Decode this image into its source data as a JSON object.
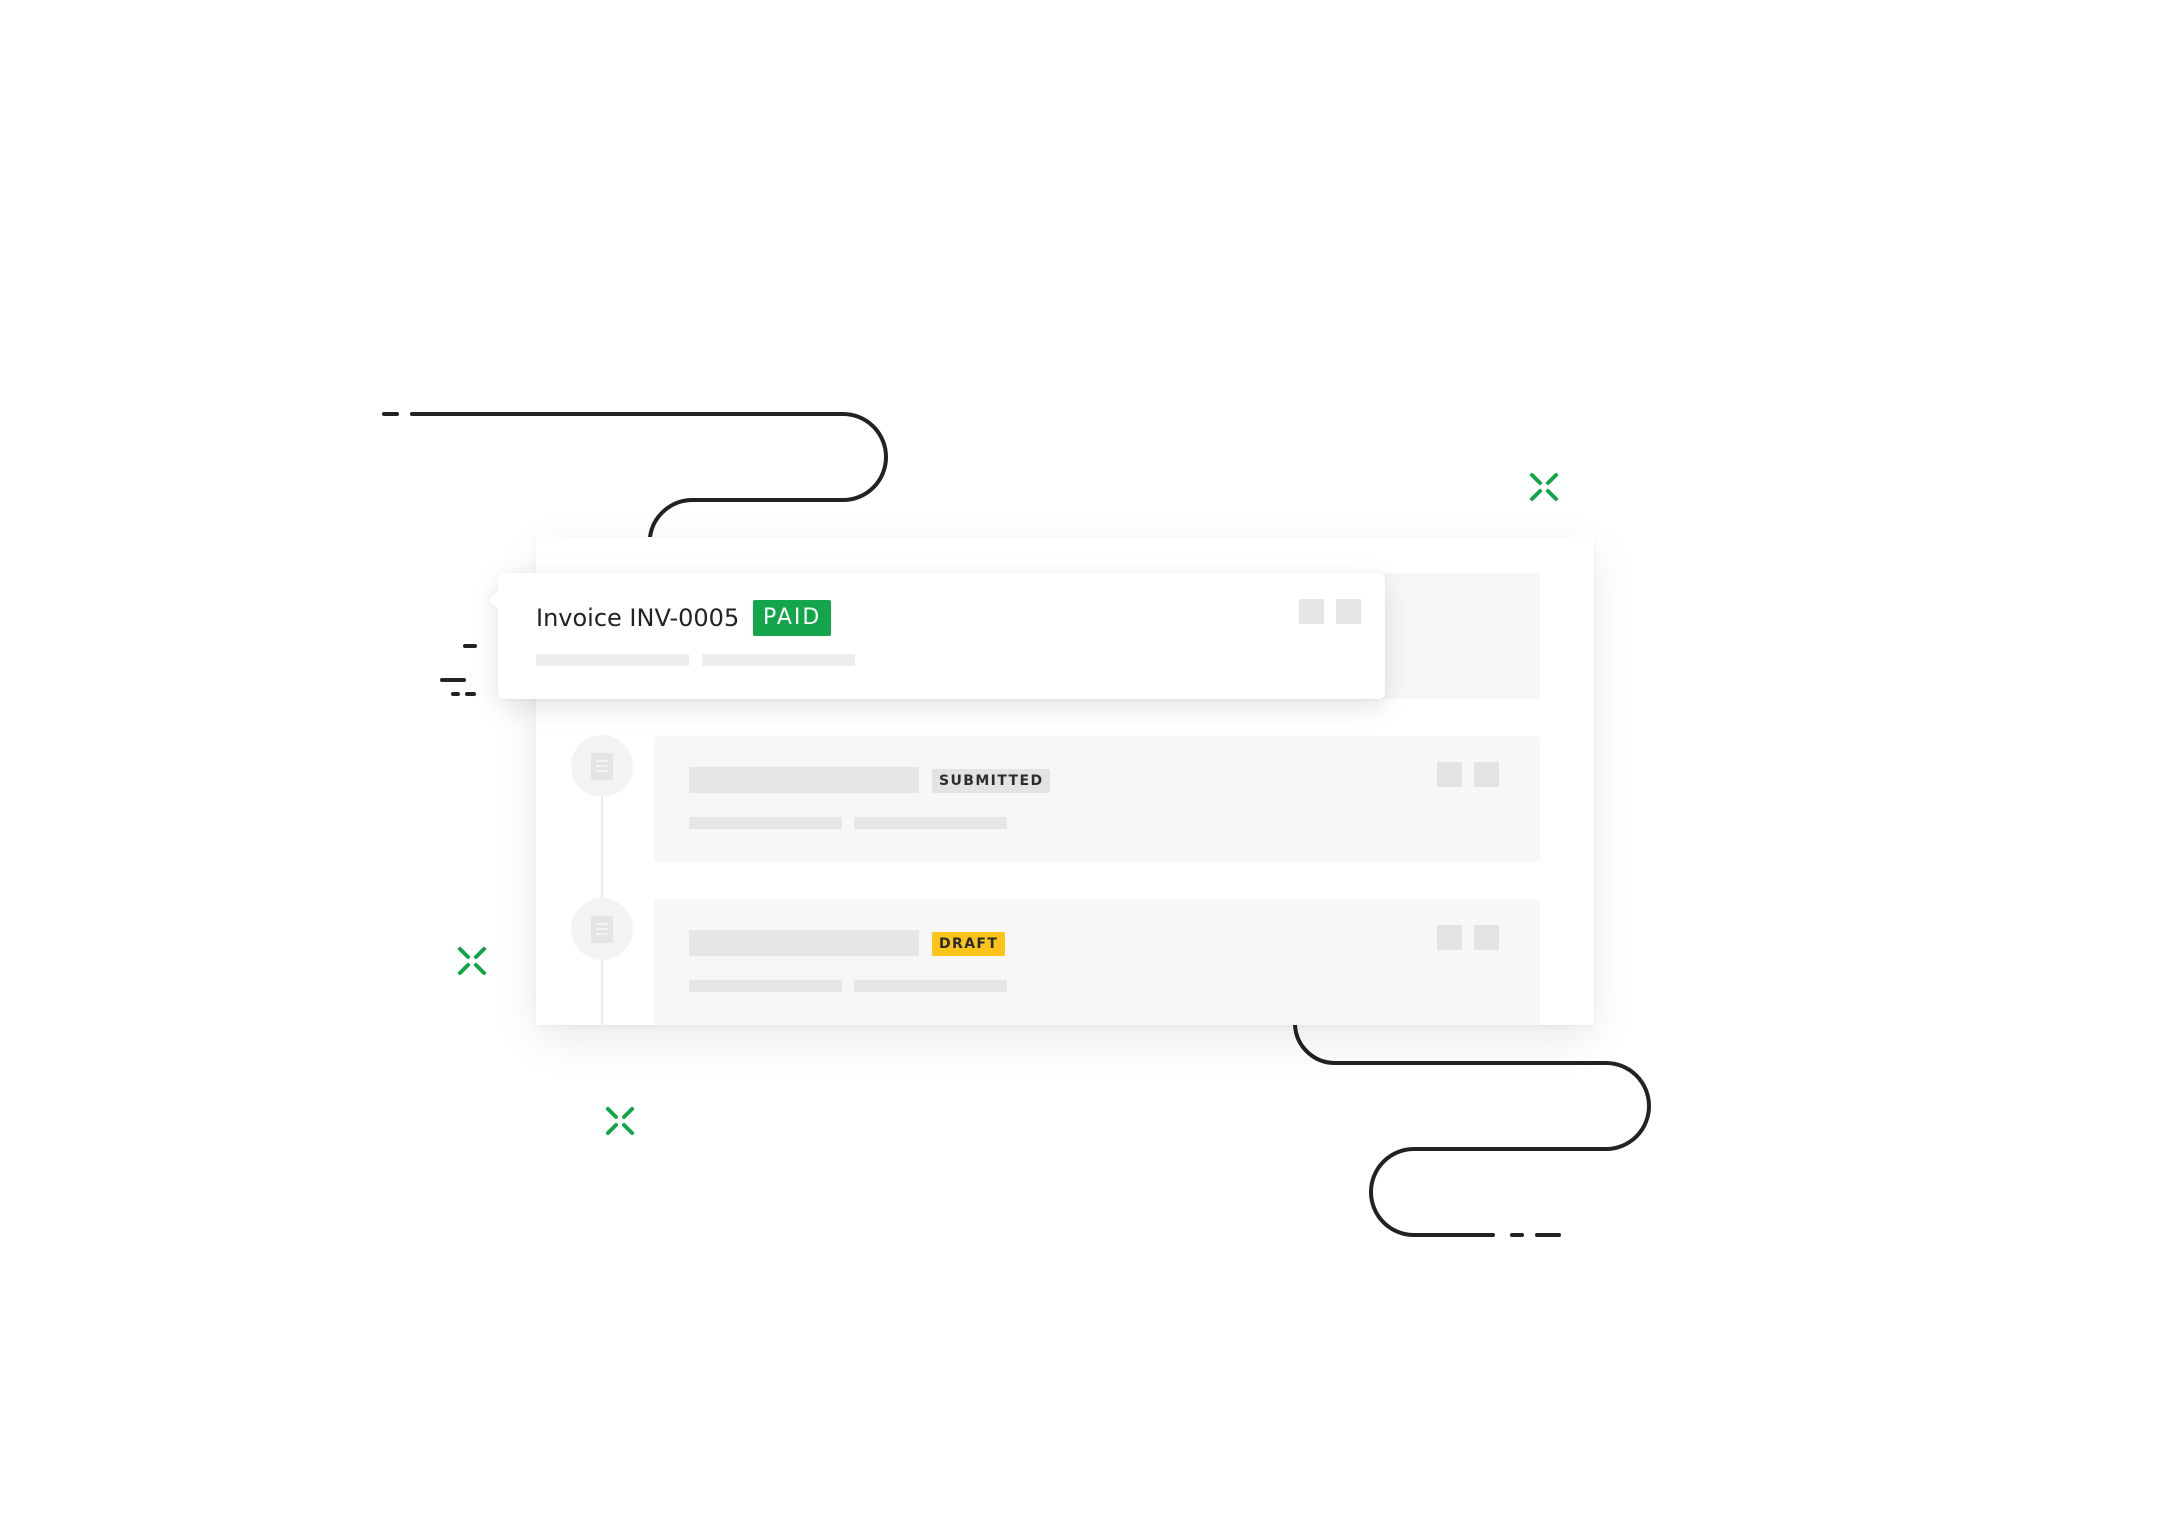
{
  "invoice_card": {
    "title": "Invoice INV-0005",
    "status": "PAID"
  },
  "rows": [
    {
      "status": "SUBMITTED",
      "icon": "document-icon"
    },
    {
      "status": "DRAFT",
      "icon": "document-icon"
    }
  ],
  "colors": {
    "paid": "#12a54a",
    "draft": "#fcc419",
    "submitted": "#e3e3e3",
    "accent_sparkle": "#12a54a",
    "line": "#222222"
  }
}
